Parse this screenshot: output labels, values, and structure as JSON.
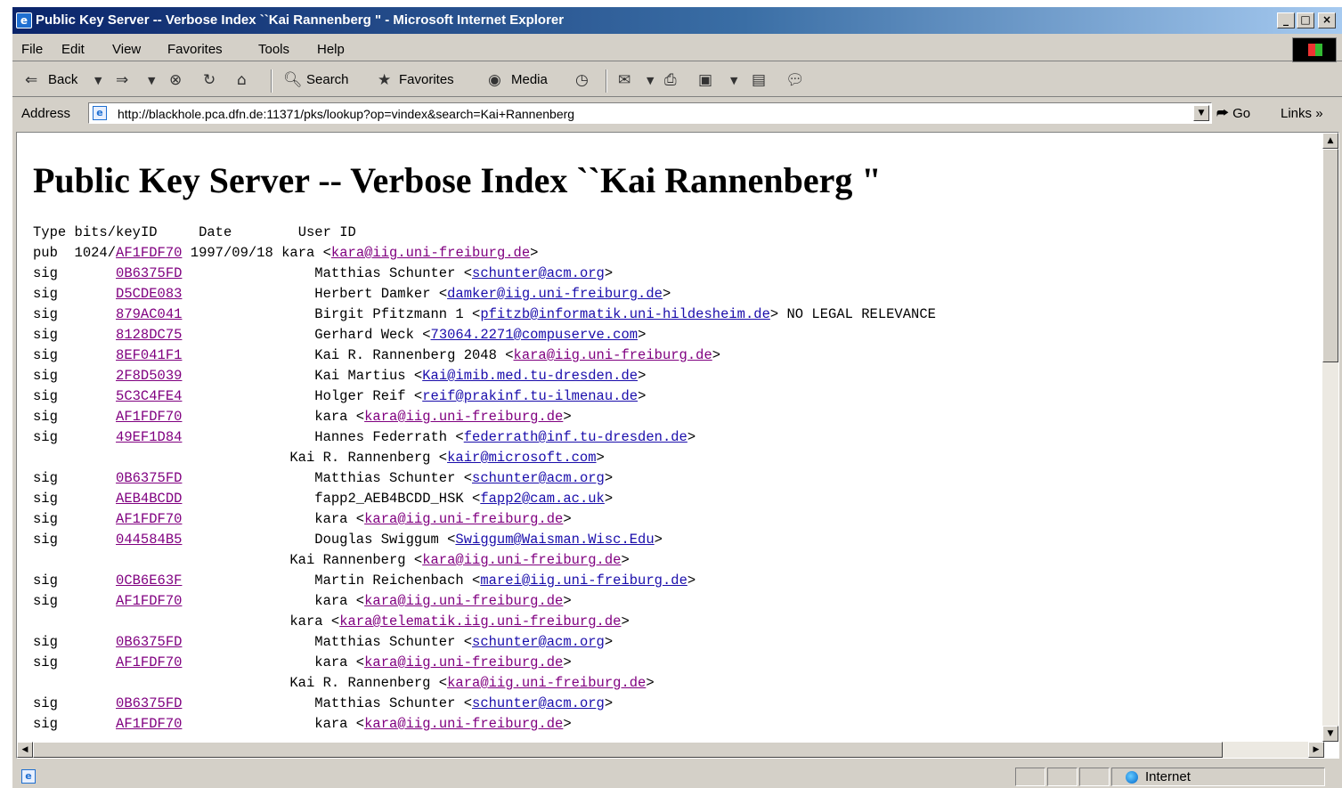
{
  "window": {
    "title": "Public Key Server -- Verbose Index ``Kai Rannenberg \" - Microsoft Internet Explorer"
  },
  "menu": [
    "File",
    "Edit",
    "View",
    "Favorites",
    "Tools",
    "Help"
  ],
  "toolbar": {
    "back": "Back",
    "search": "Search",
    "favorites": "Favorites",
    "media": "Media"
  },
  "address": {
    "label": "Address",
    "url": "http://blackhole.pca.dfn.de:11371/pks/lookup?op=vindex&search=Kai+Rannenberg",
    "go": "Go",
    "links": "Links"
  },
  "page": {
    "heading": "Public Key Server -- Verbose Index ``Kai Rannenberg \"",
    "columns": {
      "type": "Type",
      "bits_keyid": "bits/keyID",
      "date": "Date",
      "userid": "User ID"
    },
    "key": {
      "type": "pub",
      "bits": "1024/",
      "keyid": "AF1FDF70",
      "date": "1997/09/18",
      "userid": "kara",
      "email": "kara@iig.uni-freiburg.de"
    },
    "rows": [
      {
        "kind": "sig",
        "keyid": "0B6375FD",
        "name": "Matthias Schunter",
        "email": "schunter@acm.org",
        "visited": false
      },
      {
        "kind": "sig",
        "keyid": "D5CDE083",
        "name": "Herbert Damker",
        "email": "damker@iig.uni-freiburg.de",
        "visited": false
      },
      {
        "kind": "sig",
        "keyid": "879AC041",
        "name": "Birgit Pfitzmann 1",
        "email": "pfitzb@informatik.uni-hildesheim.de",
        "suffix": " NO LEGAL RELEVANCE",
        "visited": false
      },
      {
        "kind": "sig",
        "keyid": "8128DC75",
        "name": "Gerhard Weck",
        "email": "73064.2271@compuserve.com",
        "visited": false
      },
      {
        "kind": "sig",
        "keyid": "8EF041F1",
        "name": "Kai R. Rannenberg 2048",
        "email": "kara@iig.uni-freiburg.de",
        "visited": true
      },
      {
        "kind": "sig",
        "keyid": "2F8D5039",
        "name": "Kai Martius",
        "email": "Kai@imib.med.tu-dresden.de",
        "visited": false
      },
      {
        "kind": "sig",
        "keyid": "5C3C4FE4",
        "name": "Holger Reif",
        "email": "reif@prakinf.tu-ilmenau.de",
        "visited": false
      },
      {
        "kind": "sig",
        "keyid": "AF1FDF70",
        "name": "kara",
        "email": "kara@iig.uni-freiburg.de",
        "visited": true
      },
      {
        "kind": "sig",
        "keyid": "49EF1D84",
        "name": "Hannes Federrath",
        "email": "federrath@inf.tu-dresden.de",
        "visited": false
      },
      {
        "kind": "uid",
        "name": "Kai R. Rannenberg",
        "email": "kair@microsoft.com",
        "visited": false
      },
      {
        "kind": "sig",
        "keyid": "0B6375FD",
        "name": "Matthias Schunter",
        "email": "schunter@acm.org",
        "visited": false
      },
      {
        "kind": "sig",
        "keyid": "AEB4BCDD",
        "name": "fapp2_AEB4BCDD_HSK",
        "email": "fapp2@cam.ac.uk",
        "visited": false
      },
      {
        "kind": "sig",
        "keyid": "AF1FDF70",
        "name": "kara",
        "email": "kara@iig.uni-freiburg.de",
        "visited": true
      },
      {
        "kind": "sig",
        "keyid": "044584B5",
        "name": "Douglas Swiggum",
        "email": "Swiggum@Waisman.Wisc.Edu",
        "visited": false
      },
      {
        "kind": "uid",
        "name": "Kai Rannenberg",
        "email": "kara@iig.uni-freiburg.de",
        "visited": true
      },
      {
        "kind": "sig",
        "keyid": "0CB6E63F",
        "name": "Martin Reichenbach",
        "email": "marei@iig.uni-freiburg.de",
        "visited": false
      },
      {
        "kind": "sig",
        "keyid": "AF1FDF70",
        "name": "kara",
        "email": "kara@iig.uni-freiburg.de",
        "visited": true
      },
      {
        "kind": "uid",
        "name": "kara",
        "email": "kara@telematik.iig.uni-freiburg.de",
        "visited": true
      },
      {
        "kind": "sig",
        "keyid": "0B6375FD",
        "name": "Matthias Schunter",
        "email": "schunter@acm.org",
        "visited": false
      },
      {
        "kind": "sig",
        "keyid": "AF1FDF70",
        "name": "kara",
        "email": "kara@iig.uni-freiburg.de",
        "visited": true
      },
      {
        "kind": "uid",
        "name": "Kai R. Rannenberg",
        "email": "kara@iig.uni-freiburg.de",
        "visited": true
      },
      {
        "kind": "sig",
        "keyid": "0B6375FD",
        "name": "Matthias Schunter",
        "email": "schunter@acm.org",
        "visited": false
      },
      {
        "kind": "sig",
        "keyid": "AF1FDF70",
        "name": "kara",
        "email": "kara@iig.uni-freiburg.de",
        "visited": true
      }
    ]
  },
  "status": {
    "zone": "Internet"
  },
  "colors": {
    "link": "#1a0dab",
    "visited_link": "#800080",
    "title_bar": "#0a246a",
    "chrome": "#d4d0c8"
  }
}
